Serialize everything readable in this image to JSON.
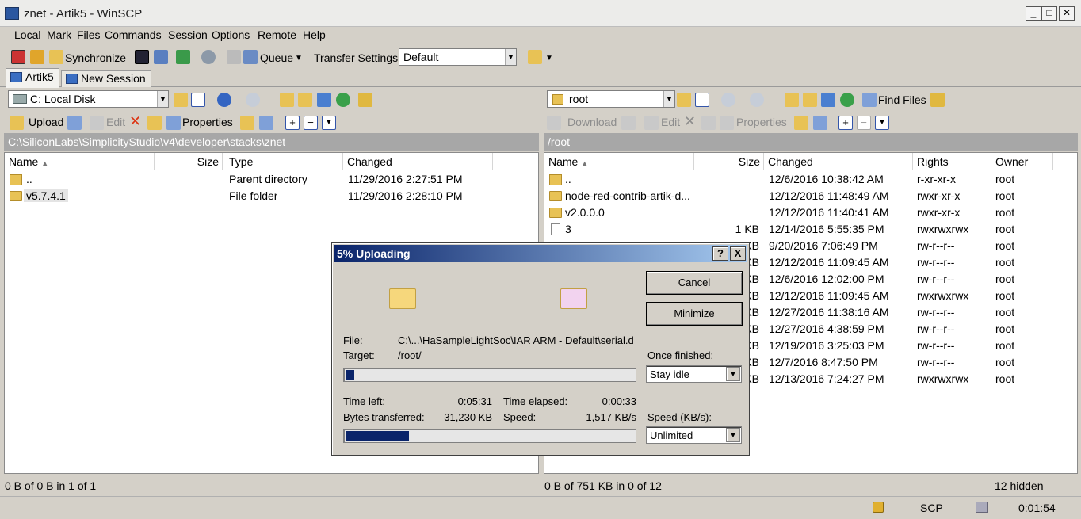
{
  "window": {
    "title": "znet - Artik5 - WinSCP"
  },
  "menu": [
    "Local",
    "Mark",
    "Files",
    "Commands",
    "Session",
    "Options",
    "Remote",
    "Help"
  ],
  "toolbar": {
    "synchronize": "Synchronize",
    "queue": "Queue",
    "transfer_settings_label": "Transfer Settings",
    "transfer_settings_value": "Default"
  },
  "tabs": [
    "Artik5",
    "New Session"
  ],
  "local": {
    "drive": "C: Local Disk",
    "upload": "Upload",
    "edit": "Edit",
    "properties": "Properties",
    "path": "C:\\SiliconLabs\\SimplicityStudio\\v4\\developer\\stacks\\znet",
    "columns": [
      "Name",
      "Size",
      "Type",
      "Changed"
    ],
    "rows": [
      {
        "name": "..",
        "size": "",
        "type": "Parent directory",
        "changed": "11/29/2016  2:27:51 PM"
      },
      {
        "name": "v5.7.4.1",
        "size": "",
        "type": "File folder",
        "changed": "11/29/2016  2:28:10 PM"
      }
    ],
    "status": "0 B of 0 B in 1 of 1"
  },
  "remote": {
    "dir": "root",
    "find_files": "Find Files",
    "download": "Download",
    "edit": "Edit",
    "properties": "Properties",
    "path": "/root",
    "columns": [
      "Name",
      "Size",
      "Changed",
      "Rights",
      "Owner"
    ],
    "rows": [
      {
        "name": "..",
        "size": "",
        "changed": "12/6/2016 10:38:42 AM",
        "rights": "r-xr-xr-x",
        "owner": "root"
      },
      {
        "name": "node-red-contrib-artik-d...",
        "size": "",
        "changed": "12/12/2016 11:48:49 AM",
        "rights": "rwxr-xr-x",
        "owner": "root"
      },
      {
        "name": "v2.0.0.0",
        "size": "",
        "changed": "12/12/2016 11:40:41 AM",
        "rights": "rwxr-xr-x",
        "owner": "root"
      },
      {
        "name": "3",
        "size": "1 KB",
        "changed": "12/14/2016 5:55:35 PM",
        "rights": "rwxrwxrwx",
        "owner": "root"
      },
      {
        "name": "",
        "size": "KB",
        "changed": "9/20/2016 7:06:49 PM",
        "rights": "rw-r--r--",
        "owner": "root"
      },
      {
        "name": "",
        "size": "KB",
        "changed": "12/12/2016 11:09:45 AM",
        "rights": "rw-r--r--",
        "owner": "root"
      },
      {
        "name": "",
        "size": "KB",
        "changed": "12/6/2016 12:02:00 PM",
        "rights": "rw-r--r--",
        "owner": "root"
      },
      {
        "name": "",
        "size": "KB",
        "changed": "12/12/2016 11:09:45 AM",
        "rights": "rwxrwxrwx",
        "owner": "root"
      },
      {
        "name": "",
        "size": "KB",
        "changed": "12/27/2016 11:38:16 AM",
        "rights": "rw-r--r--",
        "owner": "root"
      },
      {
        "name": "",
        "size": "KB",
        "changed": "12/27/2016 4:38:59 PM",
        "rights": "rw-r--r--",
        "owner": "root"
      },
      {
        "name": "",
        "size": "KB",
        "changed": "12/19/2016 3:25:03 PM",
        "rights": "rw-r--r--",
        "owner": "root"
      },
      {
        "name": "",
        "size": "KB",
        "changed": "12/7/2016 8:47:50 PM",
        "rights": "rw-r--r--",
        "owner": "root"
      },
      {
        "name": "",
        "size": "KB",
        "changed": "12/13/2016 7:24:27 PM",
        "rights": "rwxrwxrwx",
        "owner": "root"
      }
    ],
    "status": "0 B of 751 KB in 0 of 12",
    "hidden": "12 hidden"
  },
  "bottom": {
    "protocol": "SCP",
    "time": "0:01:54"
  },
  "dialog": {
    "title": "5% Uploading",
    "help": "?",
    "close": "X",
    "cancel": "Cancel",
    "minimize": "Minimize",
    "file_label": "File:",
    "file_value": "C:\\...\\HaSampleLightSoc\\IAR ARM - Default\\serial.d",
    "target_label": "Target:",
    "target_value": "/root/",
    "file_progress": 0.03,
    "time_left_label": "Time left:",
    "time_left": "0:05:31",
    "time_elapsed_label": "Time elapsed:",
    "time_elapsed": "0:00:33",
    "bytes_label": "Bytes transferred:",
    "bytes": "31,230 KB",
    "speed_label": "Speed:",
    "speed": "1,517 KB/s",
    "total_progress": 0.22,
    "once_finished_label": "Once finished:",
    "once_finished": "Stay idle",
    "speed_limit_label": "Speed (KB/s):",
    "speed_limit": "Unlimited"
  }
}
